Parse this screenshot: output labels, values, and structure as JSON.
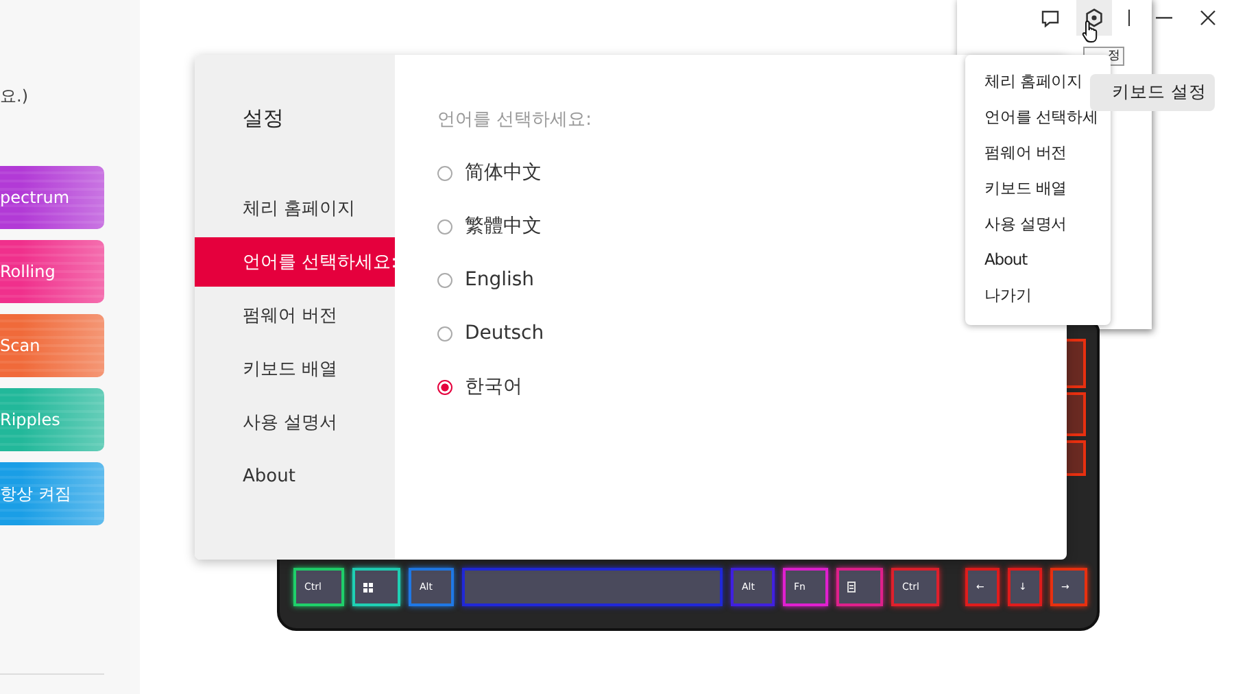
{
  "sidebar": {
    "note": "요.)",
    "effects": [
      {
        "label": "pectrum",
        "color": "#b23ad6"
      },
      {
        "label": "Rolling",
        "color": "#f0308c"
      },
      {
        "label": "Scan",
        "color": "#f06a3a"
      },
      {
        "label": "Ripples",
        "color": "#22b89a"
      },
      {
        "label": "항상 켜짐",
        "color": "#1a9ee6"
      }
    ]
  },
  "tooltip": "정",
  "keyboard_settings_button": "키보드 설정",
  "keyboard": {
    "keys": [
      {
        "kind": "text",
        "label": "Ctrl",
        "color": "#1fd06a"
      },
      {
        "kind": "windows",
        "color": "#1fd0b4"
      },
      {
        "kind": "text",
        "label": "Alt",
        "color": "#1f78e6"
      },
      {
        "kind": "space",
        "color": "#2028d8"
      },
      {
        "kind": "text",
        "label": "Alt",
        "color": "#4020e0"
      },
      {
        "kind": "text",
        "label": "Fn",
        "color": "#e020d0"
      },
      {
        "kind": "menu",
        "color": "#e0208c"
      },
      {
        "kind": "text",
        "label": "Ctrl",
        "color": "#e0202c"
      },
      {
        "kind": "text",
        "label": "←",
        "color": "#e01c1c"
      },
      {
        "kind": "text",
        "label": "↓",
        "color": "#e01c1c"
      },
      {
        "kind": "text",
        "label": "→",
        "color": "#e83010"
      }
    ]
  },
  "settings_dialog": {
    "title": "설정",
    "nav": [
      {
        "label": "체리 홈페이지",
        "selected": false
      },
      {
        "label": "언어를 선택하세요:",
        "selected": true
      },
      {
        "label": "펌웨어 버전",
        "selected": false
      },
      {
        "label": "키보드 배열",
        "selected": false
      },
      {
        "label": "사용 설명서",
        "selected": false
      },
      {
        "label": "About",
        "selected": false
      }
    ],
    "heading": "언어를 선택하세요:",
    "languages": [
      {
        "label": "简体中文",
        "selected": false
      },
      {
        "label": "繁體中文",
        "selected": false
      },
      {
        "label": "English",
        "selected": false
      },
      {
        "label": "Deutsch",
        "selected": false
      },
      {
        "label": "한국어",
        "selected": true
      }
    ]
  },
  "settings_menu": {
    "items": [
      "체리 홈페이지",
      "언어를 선택하세",
      "펌웨어 버전",
      "키보드 배열",
      "사용 설명서",
      "About",
      "나가기"
    ]
  }
}
